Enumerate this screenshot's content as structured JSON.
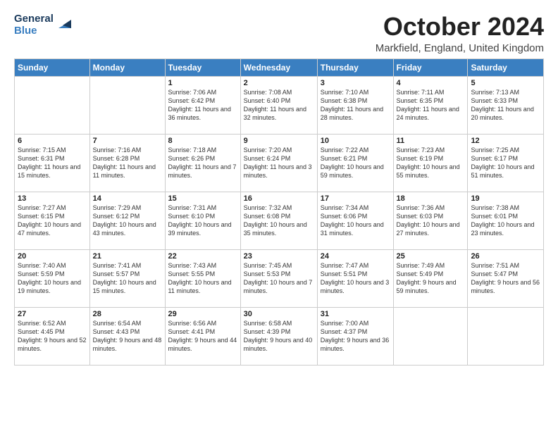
{
  "logo": {
    "line1": "General",
    "line2": "Blue"
  },
  "title": "October 2024",
  "location": "Markfield, England, United Kingdom",
  "headers": [
    "Sunday",
    "Monday",
    "Tuesday",
    "Wednesday",
    "Thursday",
    "Friday",
    "Saturday"
  ],
  "weeks": [
    [
      {
        "day": "",
        "sunrise": "",
        "sunset": "",
        "daylight": ""
      },
      {
        "day": "",
        "sunrise": "",
        "sunset": "",
        "daylight": ""
      },
      {
        "day": "1",
        "sunrise": "Sunrise: 7:06 AM",
        "sunset": "Sunset: 6:42 PM",
        "daylight": "Daylight: 11 hours and 36 minutes."
      },
      {
        "day": "2",
        "sunrise": "Sunrise: 7:08 AM",
        "sunset": "Sunset: 6:40 PM",
        "daylight": "Daylight: 11 hours and 32 minutes."
      },
      {
        "day": "3",
        "sunrise": "Sunrise: 7:10 AM",
        "sunset": "Sunset: 6:38 PM",
        "daylight": "Daylight: 11 hours and 28 minutes."
      },
      {
        "day": "4",
        "sunrise": "Sunrise: 7:11 AM",
        "sunset": "Sunset: 6:35 PM",
        "daylight": "Daylight: 11 hours and 24 minutes."
      },
      {
        "day": "5",
        "sunrise": "Sunrise: 7:13 AM",
        "sunset": "Sunset: 6:33 PM",
        "daylight": "Daylight: 11 hours and 20 minutes."
      }
    ],
    [
      {
        "day": "6",
        "sunrise": "Sunrise: 7:15 AM",
        "sunset": "Sunset: 6:31 PM",
        "daylight": "Daylight: 11 hours and 15 minutes."
      },
      {
        "day": "7",
        "sunrise": "Sunrise: 7:16 AM",
        "sunset": "Sunset: 6:28 PM",
        "daylight": "Daylight: 11 hours and 11 minutes."
      },
      {
        "day": "8",
        "sunrise": "Sunrise: 7:18 AM",
        "sunset": "Sunset: 6:26 PM",
        "daylight": "Daylight: 11 hours and 7 minutes."
      },
      {
        "day": "9",
        "sunrise": "Sunrise: 7:20 AM",
        "sunset": "Sunset: 6:24 PM",
        "daylight": "Daylight: 11 hours and 3 minutes."
      },
      {
        "day": "10",
        "sunrise": "Sunrise: 7:22 AM",
        "sunset": "Sunset: 6:21 PM",
        "daylight": "Daylight: 10 hours and 59 minutes."
      },
      {
        "day": "11",
        "sunrise": "Sunrise: 7:23 AM",
        "sunset": "Sunset: 6:19 PM",
        "daylight": "Daylight: 10 hours and 55 minutes."
      },
      {
        "day": "12",
        "sunrise": "Sunrise: 7:25 AM",
        "sunset": "Sunset: 6:17 PM",
        "daylight": "Daylight: 10 hours and 51 minutes."
      }
    ],
    [
      {
        "day": "13",
        "sunrise": "Sunrise: 7:27 AM",
        "sunset": "Sunset: 6:15 PM",
        "daylight": "Daylight: 10 hours and 47 minutes."
      },
      {
        "day": "14",
        "sunrise": "Sunrise: 7:29 AM",
        "sunset": "Sunset: 6:12 PM",
        "daylight": "Daylight: 10 hours and 43 minutes."
      },
      {
        "day": "15",
        "sunrise": "Sunrise: 7:31 AM",
        "sunset": "Sunset: 6:10 PM",
        "daylight": "Daylight: 10 hours and 39 minutes."
      },
      {
        "day": "16",
        "sunrise": "Sunrise: 7:32 AM",
        "sunset": "Sunset: 6:08 PM",
        "daylight": "Daylight: 10 hours and 35 minutes."
      },
      {
        "day": "17",
        "sunrise": "Sunrise: 7:34 AM",
        "sunset": "Sunset: 6:06 PM",
        "daylight": "Daylight: 10 hours and 31 minutes."
      },
      {
        "day": "18",
        "sunrise": "Sunrise: 7:36 AM",
        "sunset": "Sunset: 6:03 PM",
        "daylight": "Daylight: 10 hours and 27 minutes."
      },
      {
        "day": "19",
        "sunrise": "Sunrise: 7:38 AM",
        "sunset": "Sunset: 6:01 PM",
        "daylight": "Daylight: 10 hours and 23 minutes."
      }
    ],
    [
      {
        "day": "20",
        "sunrise": "Sunrise: 7:40 AM",
        "sunset": "Sunset: 5:59 PM",
        "daylight": "Daylight: 10 hours and 19 minutes."
      },
      {
        "day": "21",
        "sunrise": "Sunrise: 7:41 AM",
        "sunset": "Sunset: 5:57 PM",
        "daylight": "Daylight: 10 hours and 15 minutes."
      },
      {
        "day": "22",
        "sunrise": "Sunrise: 7:43 AM",
        "sunset": "Sunset: 5:55 PM",
        "daylight": "Daylight: 10 hours and 11 minutes."
      },
      {
        "day": "23",
        "sunrise": "Sunrise: 7:45 AM",
        "sunset": "Sunset: 5:53 PM",
        "daylight": "Daylight: 10 hours and 7 minutes."
      },
      {
        "day": "24",
        "sunrise": "Sunrise: 7:47 AM",
        "sunset": "Sunset: 5:51 PM",
        "daylight": "Daylight: 10 hours and 3 minutes."
      },
      {
        "day": "25",
        "sunrise": "Sunrise: 7:49 AM",
        "sunset": "Sunset: 5:49 PM",
        "daylight": "Daylight: 9 hours and 59 minutes."
      },
      {
        "day": "26",
        "sunrise": "Sunrise: 7:51 AM",
        "sunset": "Sunset: 5:47 PM",
        "daylight": "Daylight: 9 hours and 56 minutes."
      }
    ],
    [
      {
        "day": "27",
        "sunrise": "Sunrise: 6:52 AM",
        "sunset": "Sunset: 4:45 PM",
        "daylight": "Daylight: 9 hours and 52 minutes."
      },
      {
        "day": "28",
        "sunrise": "Sunrise: 6:54 AM",
        "sunset": "Sunset: 4:43 PM",
        "daylight": "Daylight: 9 hours and 48 minutes."
      },
      {
        "day": "29",
        "sunrise": "Sunrise: 6:56 AM",
        "sunset": "Sunset: 4:41 PM",
        "daylight": "Daylight: 9 hours and 44 minutes."
      },
      {
        "day": "30",
        "sunrise": "Sunrise: 6:58 AM",
        "sunset": "Sunset: 4:39 PM",
        "daylight": "Daylight: 9 hours and 40 minutes."
      },
      {
        "day": "31",
        "sunrise": "Sunrise: 7:00 AM",
        "sunset": "Sunset: 4:37 PM",
        "daylight": "Daylight: 9 hours and 36 minutes."
      },
      {
        "day": "",
        "sunrise": "",
        "sunset": "",
        "daylight": ""
      },
      {
        "day": "",
        "sunrise": "",
        "sunset": "",
        "daylight": ""
      }
    ]
  ]
}
